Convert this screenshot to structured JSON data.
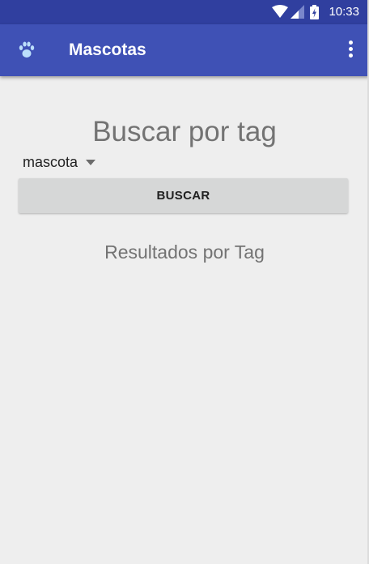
{
  "status_bar": {
    "time": "10:33",
    "icons": [
      "wifi-icon",
      "signal-icon",
      "battery-charging-icon"
    ]
  },
  "app_bar": {
    "logo_icon": "paw-icon",
    "title": "Mascotas",
    "menu_icon": "more-vert-icon"
  },
  "main": {
    "heading": "Buscar por tag",
    "spinner": {
      "selected": "mascota"
    },
    "search_button_label": "BUSCAR",
    "results_label": "Resultados por Tag"
  },
  "colors": {
    "status_bar": "#303f9f",
    "app_bar": "#3f51b5",
    "background": "#eeeeee",
    "button": "#d6d7d7"
  }
}
